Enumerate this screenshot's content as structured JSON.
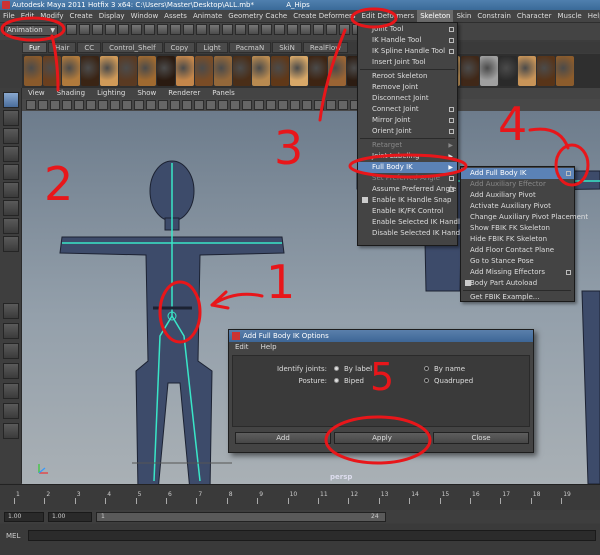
{
  "window": {
    "title": "Autodesk Maya 2011 Hotfix 3 x64: C:\\Users\\Master\\Desktop\\ALL.mb*",
    "object": "A_Hips"
  },
  "menubar": [
    "File",
    "Edit",
    "Modify",
    "Create",
    "Display",
    "Window",
    "Assets",
    "Animate",
    "Geometry Cache",
    "Create Deformers",
    "Edit Deformers",
    "Skeleton",
    "Skin",
    "Constrain",
    "Character",
    "Muscle",
    "Help"
  ],
  "status": {
    "mode": "Animation"
  },
  "shelf_tabs": [
    "Fur",
    "Hair",
    "CC",
    "Control_Shelf",
    "Copy",
    "Light",
    "PacmaN",
    "SkiN",
    "RealFlow"
  ],
  "viewport": {
    "menu": [
      "View",
      "Shading",
      "Lighting",
      "Show",
      "Renderer",
      "Panels"
    ],
    "camera_label": "persp"
  },
  "skeleton_menu": [
    {
      "label": "Joint Tool",
      "option": true
    },
    {
      "label": "IK Handle Tool",
      "option": true
    },
    {
      "label": "IK Spline Handle Tool",
      "option": true
    },
    {
      "label": "Insert Joint Tool"
    },
    {
      "sep": true
    },
    {
      "label": "Reroot Skeleton"
    },
    {
      "label": "Remove Joint"
    },
    {
      "label": "Disconnect Joint"
    },
    {
      "label": "Connect Joint",
      "option": true
    },
    {
      "label": "Mirror Joint",
      "option": true
    },
    {
      "label": "Orient Joint",
      "option": true
    },
    {
      "sep": true
    },
    {
      "label": "Retarget",
      "submenu": true,
      "disabled": true
    },
    {
      "label": "Joint Labeling",
      "submenu": true
    },
    {
      "label": "Full Body IK",
      "submenu": true,
      "highlight": true
    },
    {
      "label": "Set Preferred Angle",
      "option": true,
      "disabled": true
    },
    {
      "label": "Assume Preferred Angle",
      "option": true
    },
    {
      "label": "Enable IK Handle Snap",
      "checked": true
    },
    {
      "label": "Enable IK/FK Control",
      "checked": false
    },
    {
      "label": "Enable Selected IK Handles"
    },
    {
      "label": "Disable Selected IK Handles"
    }
  ],
  "fbik_menu": [
    {
      "label": "Add Full Body IK",
      "option": true,
      "highlight": true
    },
    {
      "label": "Add Auxiliary Effector",
      "disabled": true
    },
    {
      "label": "Add Auxiliary Pivot"
    },
    {
      "label": "Activate Auxiliary Pivot"
    },
    {
      "label": "Change Auxiliary Pivot Placement"
    },
    {
      "label": "Show FBIK FK Skeleton"
    },
    {
      "label": "Hide FBIK FK Skeleton"
    },
    {
      "label": "Add Floor Contact Plane"
    },
    {
      "label": "Go to Stance Pose"
    },
    {
      "label": "Add Missing Effectors",
      "option": true
    },
    {
      "label": "Body Part Autoload",
      "checked": true
    },
    {
      "sep": true
    },
    {
      "label": "Get FBIK Example..."
    }
  ],
  "dialog": {
    "title": "Add Full Body IK Options",
    "menu": [
      "Edit",
      "Help"
    ],
    "identify_label": "Identify joints:",
    "identify_options": [
      {
        "label": "By label",
        "selected": true
      },
      {
        "label": "By name",
        "selected": false
      }
    ],
    "posture_label": "Posture:",
    "posture_options": [
      {
        "label": "Biped",
        "selected": true
      },
      {
        "label": "Quadruped",
        "selected": false
      }
    ],
    "buttons": {
      "add": "Add",
      "apply": "Apply",
      "close": "Close"
    }
  },
  "timeline": {
    "ticks": [
      "1",
      "2",
      "3",
      "4",
      "5",
      "6",
      "7",
      "8",
      "9",
      "10",
      "11",
      "12",
      "13",
      "14",
      "15",
      "16",
      "17",
      "18",
      "19"
    ],
    "start": "1.00",
    "playback_start": "1.00",
    "range_start_label": "1",
    "range_end_label": "24"
  },
  "command_line": {
    "label": "MEL"
  },
  "annotations": [
    "1",
    "2",
    "3",
    "4",
    "5"
  ],
  "colors": {
    "annotation": "#e8161a",
    "menu_highlight": "#5b82b6",
    "skeleton_joint": "#39e6c8"
  }
}
